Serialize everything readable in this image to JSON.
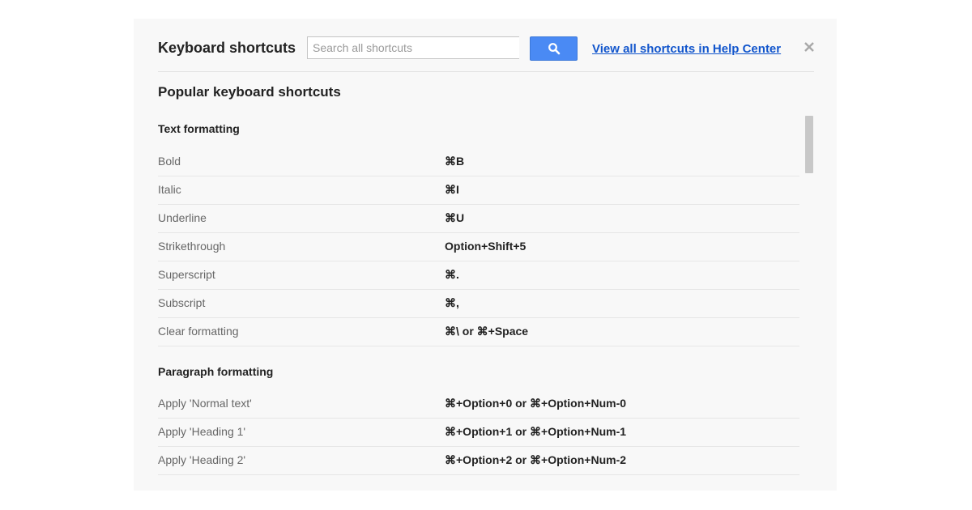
{
  "dialog": {
    "title": "Keyboard shortcuts",
    "search": {
      "placeholder": "Search all shortcuts",
      "value": ""
    },
    "search_button_icon": "search-icon",
    "help_link": "View all shortcuts in Help Center",
    "close_icon": "close-icon"
  },
  "content": {
    "heading": "Popular keyboard shortcuts",
    "groups": [
      {
        "title": "Text formatting",
        "rows": [
          {
            "action": "Bold",
            "keys": "⌘B"
          },
          {
            "action": "Italic",
            "keys": "⌘I"
          },
          {
            "action": "Underline",
            "keys": "⌘U"
          },
          {
            "action": "Strikethrough",
            "keys": "Option+Shift+5"
          },
          {
            "action": "Superscript",
            "keys": "⌘."
          },
          {
            "action": "Subscript",
            "keys": "⌘,"
          },
          {
            "action": "Clear formatting",
            "keys": "⌘\\ or ⌘+Space"
          }
        ]
      },
      {
        "title": "Paragraph formatting",
        "rows": [
          {
            "action": "Apply 'Normal text'",
            "keys": "⌘+Option+0 or ⌘+Option+Num-0"
          },
          {
            "action": "Apply 'Heading 1'",
            "keys": "⌘+Option+1 or ⌘+Option+Num-1"
          },
          {
            "action": "Apply 'Heading 2'",
            "keys": "⌘+Option+2 or ⌘+Option+Num-2"
          }
        ]
      }
    ]
  },
  "colors": {
    "dialog_background": "#f8f8f8",
    "accent_button": "#4a8af4",
    "link": "#1155cc"
  }
}
